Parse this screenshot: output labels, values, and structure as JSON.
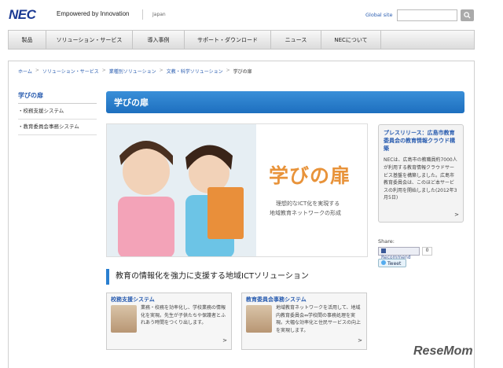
{
  "header": {
    "logo": "NEC",
    "tagline": "Empowered by Innovation",
    "region": "Japan",
    "global_link": "Global site"
  },
  "nav": {
    "items": [
      "製品",
      "ソリューション・サービス",
      "導入事例",
      "サポート・ダウンロード",
      "ニュース",
      "NECについて"
    ]
  },
  "breadcrumb": {
    "items": [
      "ホーム",
      "ソリューション・サービス",
      "業種別ソリューション",
      "文教・科学ソリューション"
    ],
    "current": "学びの扉"
  },
  "sidebar": {
    "title": "学びの扉",
    "items": [
      "・校務支援システム",
      "・教育委員会事務システム"
    ]
  },
  "main": {
    "banner_title": "学びの扉",
    "hero": {
      "brand": "学びの扉",
      "tagline_1": "理想的なICT化を実現する",
      "tagline_2": "地域教育ネットワークの形成"
    },
    "section_title": "教育の情報化を強力に支援する地域ICTソリューション",
    "cards": [
      {
        "title": "校務支援システム",
        "body": "業務・校務を効率化し、学校業務の情報化を実現。先生が子供たちや保護者とふれあう時間をつくり出します。",
        "arrow": ">"
      },
      {
        "title": "教育委員会事務システム",
        "body": "地域教育ネットワークを活用して、地域内教育委員会⇔学校間の事務処理を実現。大幅な効率化と住民サービスの向上を実現します。",
        "arrow": ">"
      }
    ]
  },
  "press": {
    "title": "プレスリリース：広島市教育委員会の教育情報クラウド構築",
    "body": "NECは、広島市の教職員約7000人が利用する教育情報クラウドサービス基盤を構築しました。広島市教育委員会は、このほど本サービスの利用を開始しました(2012年3月5日)",
    "arrow": ">"
  },
  "share": {
    "label": "Share:",
    "recommend": "Recommend",
    "recommend_count": "0",
    "tweet": "Tweet"
  },
  "watermark": "ReseMom",
  "colors": {
    "accent": "#2a5db0",
    "banner": "#1e6fbf",
    "brand_orange": "#e8933a"
  }
}
